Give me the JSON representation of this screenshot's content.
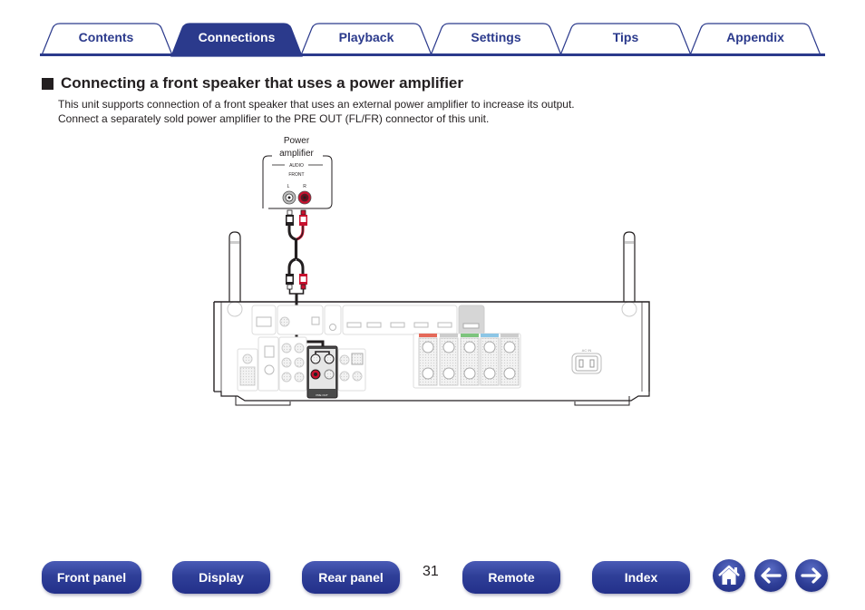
{
  "tabs": [
    {
      "label": "Contents",
      "active": false
    },
    {
      "label": "Connections",
      "active": true
    },
    {
      "label": "Playback",
      "active": false
    },
    {
      "label": "Settings",
      "active": false
    },
    {
      "label": "Tips",
      "active": false
    },
    {
      "label": "Appendix",
      "active": false
    }
  ],
  "colors": {
    "brand_blue": "#2b3a8c",
    "tab_active_fill": "#2b3a8c",
    "cable_red": "#c8102e",
    "text": "#231f20"
  },
  "section": {
    "title": "Connecting a front speaker that uses a power amplifier",
    "description_line1": "This unit supports connection of a front speaker that uses an external power amplifier to increase its output.",
    "description_line2": "Connect a separately sold power amplifier to the PRE OUT (FL/FR) connector of this unit."
  },
  "diagram": {
    "amp_label_line1": "Power",
    "amp_label_line2": "amplifier",
    "amp_audio_label": "AUDIO",
    "amp_front_label": "FRONT",
    "amp_left_label": "L",
    "amp_right_label": "R",
    "receiver_preout_label": "PRE OUT",
    "receiver_ac_label": "AC IN"
  },
  "footer": {
    "buttons": [
      {
        "label": "Front panel"
      },
      {
        "label": "Display"
      },
      {
        "label": "Rear panel"
      },
      {
        "label": "Remote"
      },
      {
        "label": "Index"
      }
    ],
    "page_number": "31",
    "icons": [
      "home-icon",
      "back-arrow-icon",
      "forward-arrow-icon"
    ]
  }
}
